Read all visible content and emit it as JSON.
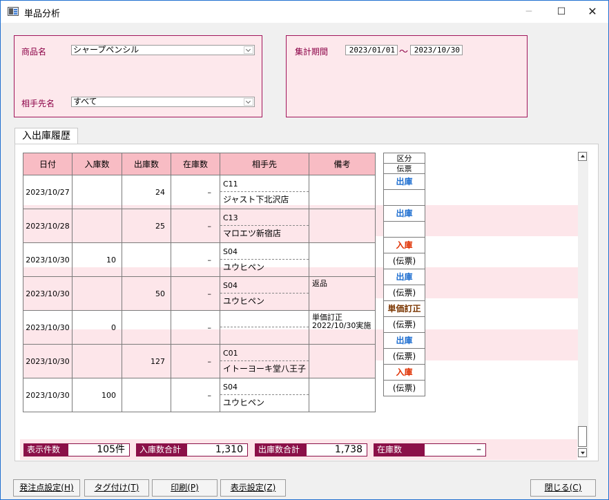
{
  "window": {
    "title": "単品分析",
    "minimize_glyph": "─",
    "maximize_glyph": "☐",
    "close_glyph": "✕",
    "icon": "app-window-icon"
  },
  "filters": {
    "product_label": "商品名",
    "product_value": "シャープペンシル",
    "partner_label": "相手先名",
    "partner_value": "すべて",
    "period_label": "集計期間",
    "date_from": "2023/01/01",
    "tilde": "～",
    "date_to": "2023/10/30"
  },
  "tab": {
    "label": "入出庫履歴"
  },
  "table": {
    "headers": [
      "日付",
      "入庫数",
      "出庫数",
      "在庫数",
      "相手先",
      "備考"
    ],
    "rows": [
      {
        "date": "2023/10/27",
        "in_qty": "",
        "out_qty": "24",
        "stock": "–",
        "code": "C11",
        "partner": "ジャスト下北沢店",
        "note1": "",
        "note2": "",
        "kind": "出庫",
        "slip": ""
      },
      {
        "date": "2023/10/28",
        "in_qty": "",
        "out_qty": "25",
        "stock": "–",
        "code": "C13",
        "partner": "マロエツ新宿店",
        "note1": "",
        "note2": "",
        "kind": "出庫",
        "slip": ""
      },
      {
        "date": "2023/10/30",
        "in_qty": "10",
        "out_qty": "",
        "stock": "–",
        "code": "S04",
        "partner": "ユウヒペン",
        "note1": "",
        "note2": "",
        "kind": "入庫",
        "slip": "(伝票)"
      },
      {
        "date": "2023/10/30",
        "in_qty": "",
        "out_qty": "50",
        "stock": "–",
        "code": "S04",
        "partner": "ユウヒペン",
        "note1": "返品",
        "note2": "",
        "kind": "出庫",
        "slip": "(伝票)"
      },
      {
        "date": "2023/10/30",
        "in_qty": "0",
        "out_qty": "",
        "stock": "–",
        "code": "",
        "partner": "",
        "note1": "単価訂正",
        "note2": "2022/10/30実施",
        "kind": "単価訂正",
        "slip": "(伝票)"
      },
      {
        "date": "2023/10/30",
        "in_qty": "",
        "out_qty": "127",
        "stock": "–",
        "code": "C01",
        "partner": "イトーヨーキ堂八王子",
        "note1": "",
        "note2": "",
        "kind": "出庫",
        "slip": "(伝票)"
      },
      {
        "date": "2023/10/30",
        "in_qty": "100",
        "out_qty": "",
        "stock": "–",
        "code": "S04",
        "partner": "ユウヒペン",
        "note1": "",
        "note2": "",
        "kind": "入庫",
        "slip": "(伝票)"
      }
    ]
  },
  "kubun": {
    "header1": "区分",
    "header2": "伝票"
  },
  "summary": {
    "count_label": "表示件数",
    "count_value": "105件",
    "in_total_label": "入庫数合計",
    "in_total_value": "1,310",
    "out_total_label": "出庫数合計",
    "out_total_value": "1,738",
    "stock_label": "在庫数",
    "stock_value": "–"
  },
  "buttons": {
    "reorder": "発注点設定(H)",
    "tag": "タグ付け(T)",
    "print": "印刷(P)",
    "display": "表示設定(Z)",
    "close": "閉じる(C)"
  },
  "colors": {
    "accent": "#8b1048",
    "header_pink": "#f8bcc4",
    "row_alt": "#fde6ea",
    "out_blue": "#1f6fd0",
    "in_red": "#e03000",
    "adjust_brown": "#7a3500"
  }
}
